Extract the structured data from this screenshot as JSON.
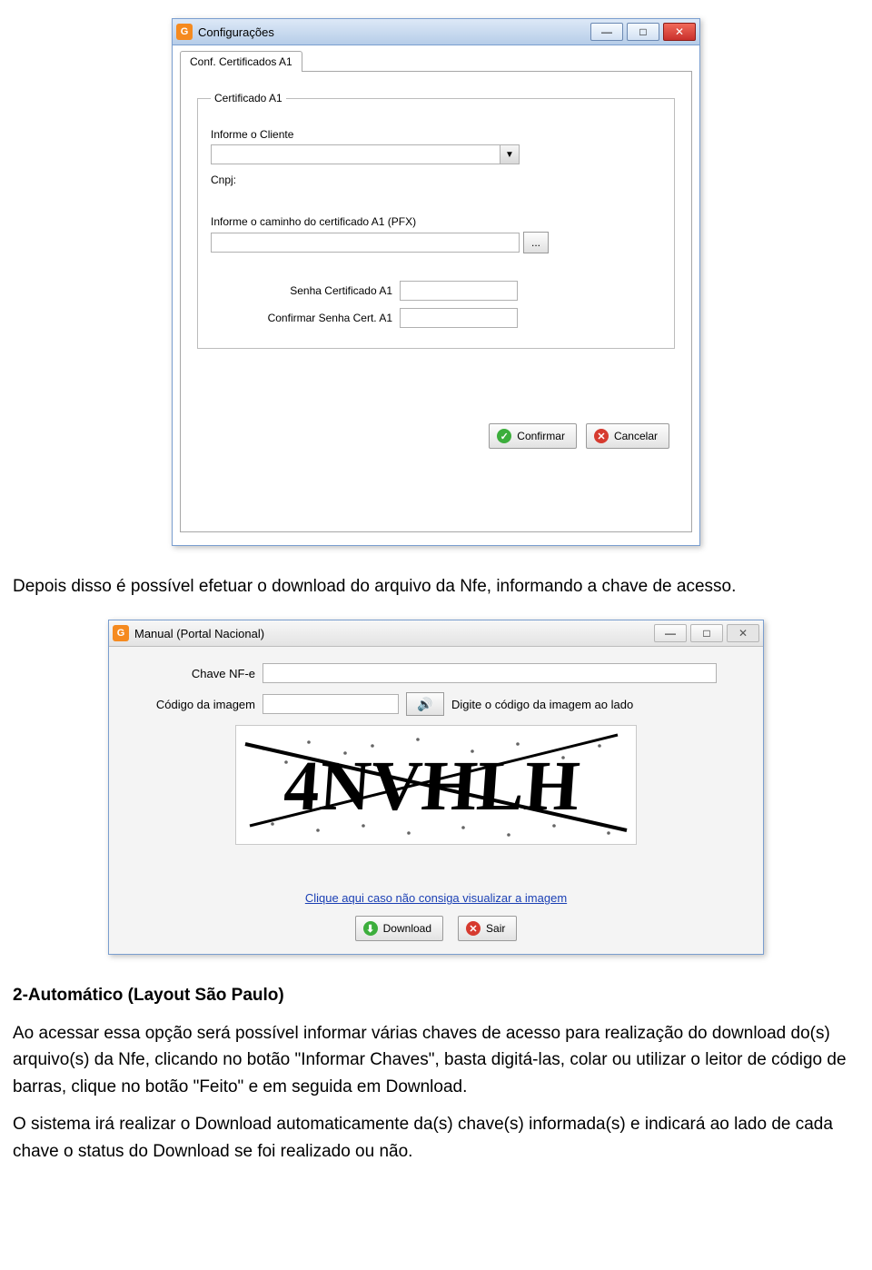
{
  "window1": {
    "title": "Configurações",
    "tab_label": "Conf. Certificados A1",
    "group_legend": "Certificado A1",
    "lbl_cliente": "Informe o Cliente",
    "lbl_cnpj": "Cnpj:",
    "lbl_path": "Informe o caminho do certificado A1 (PFX)",
    "lbl_pw": "Senha Certificado A1",
    "lbl_pw2": "Confirmar Senha Cert. A1",
    "btn_confirm": "Confirmar",
    "btn_cancel": "Cancelar",
    "btn_browse": "..."
  },
  "para1": "Depois disso é possível efetuar o download  do arquivo da Nfe, informando a chave de acesso.",
  "window2": {
    "title": "Manual (Portal Nacional)",
    "lbl_chave": "Chave NF-e",
    "lbl_codigo": "Código da imagem",
    "hint": "Digite o código da imagem ao lado",
    "captcha_text": "4NVHLH",
    "link": "Clique aqui caso não consiga visualizar a imagem",
    "btn_download": "Download",
    "btn_sair": "Sair"
  },
  "heading2": "2-Automático (Layout São Paulo)",
  "para2a": "Ao acessar essa opção será possível informar várias chaves de acesso para realização do download do(s) arquivo(s) da Nfe, clicando no botão \"Informar Chaves\", basta digitá-las, colar ou utilizar o leitor de código de barras, clique no botão \"Feito\" e em seguida em Download.",
  "para2b": "O sistema irá realizar o Download automaticamente da(s) chave(s) informada(s) e indicará ao lado de cada chave o status do Download se foi realizado ou não."
}
